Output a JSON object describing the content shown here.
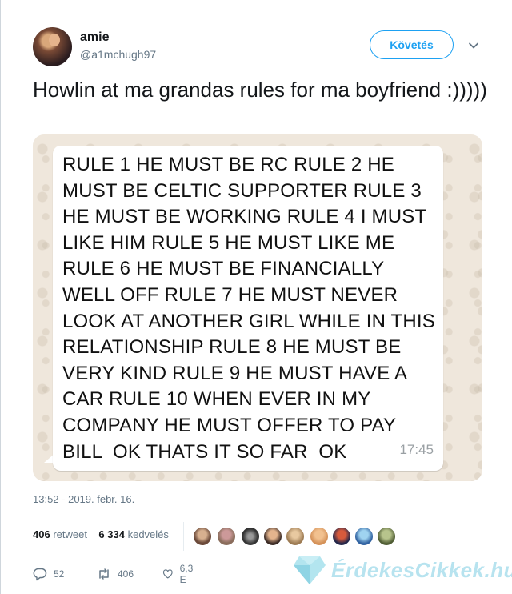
{
  "tweet": {
    "display_name": "amie",
    "handle": "@a1mchugh97",
    "follow_label": "Követés",
    "text": "Howlin at ma grandas rules for ma boyfriend :)))))",
    "timestamp": "13:52 - 2019. febr. 16."
  },
  "media": {
    "message_text": "RULE 1 HE MUST BE RC RULE 2 HE\nMUST BE CELTIC SUPPORTER RULE 3\nHE MUST BE WORKING RULE 4 I MUST\nLIKE HIM RULE 5 HE MUST LIKE ME\nRULE 6 HE MUST BE FINANCIALLY\nWELL OFF RULE 7 HE MUST NEVER\nLOOK AT ANOTHER GIRL WHILE IN THIS\nRELATIONSHIP RULE 8 HE MUST BE\nVERY KIND RULE 9 HE MUST HAVE A\nCAR RULE 10 WHEN EVER IN MY\nCOMPANY HE MUST OFFER TO PAY\nBILL  OK THATS IT SO FAR  OK",
    "message_time": "17:45"
  },
  "stats": {
    "retweets_count": "406",
    "retweets_label": "retweet",
    "likes_count": "6 334",
    "likes_label": "kedvelés"
  },
  "actions": {
    "reply_count": "52",
    "retweet_count": "406",
    "like_count": "6,3 E"
  },
  "watermark": {
    "text": "ÉrdekesCikkek.hu"
  },
  "colors": {
    "accent": "#1da1f2",
    "secondary_text": "#657786",
    "chat_background": "#efe7dc"
  }
}
